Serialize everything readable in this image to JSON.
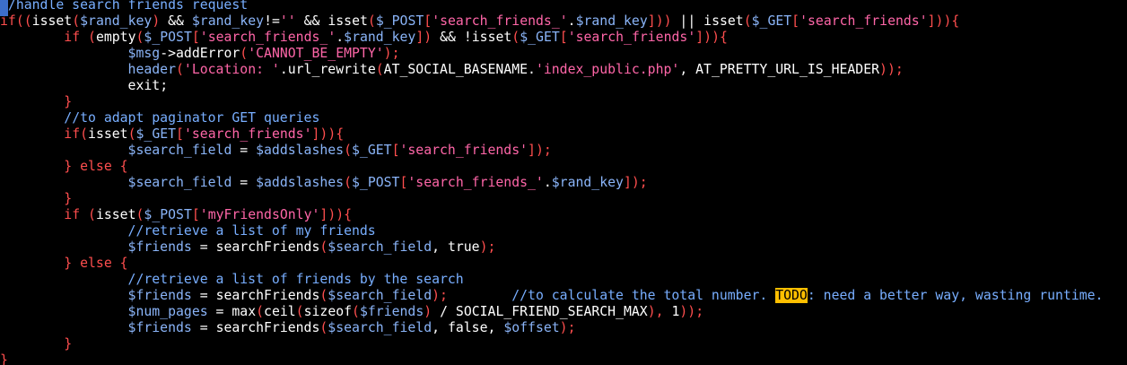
{
  "colors": {
    "background": "#000000",
    "keyword": "#ff4e4e",
    "variable": "#8ab4f8",
    "string": "#ff66a8",
    "comment": "#78aeff",
    "todo_bg": "#ffbf00"
  },
  "code": {
    "lines": [
      [
        {
          "t": "//handle search friends request",
          "c": "cmt"
        }
      ],
      [
        {
          "t": "if",
          "c": "kw"
        },
        {
          "t": "((",
          "c": "kw"
        },
        {
          "t": "isset",
          "c": "fn"
        },
        {
          "t": "(",
          "c": "kw"
        },
        {
          "t": "$rand_key",
          "c": "var"
        },
        {
          "t": ")",
          "c": "kw"
        },
        {
          "t": " && ",
          "c": "op"
        },
        {
          "t": "$rand_key",
          "c": "var"
        },
        {
          "t": "!=",
          "c": "op"
        },
        {
          "t": "''",
          "c": "str"
        },
        {
          "t": " && ",
          "c": "op"
        },
        {
          "t": "isset",
          "c": "fn"
        },
        {
          "t": "(",
          "c": "kw"
        },
        {
          "t": "$_POST",
          "c": "var"
        },
        {
          "t": "[",
          "c": "kw"
        },
        {
          "t": "'search_friends_'",
          "c": "str"
        },
        {
          "t": ".",
          "c": "op"
        },
        {
          "t": "$rand_key",
          "c": "var"
        },
        {
          "t": "]",
          "c": "kw"
        },
        {
          "t": "))",
          "c": "kw"
        },
        {
          "t": " || ",
          "c": "op"
        },
        {
          "t": "isset",
          "c": "fn"
        },
        {
          "t": "(",
          "c": "kw"
        },
        {
          "t": "$_GET",
          "c": "var"
        },
        {
          "t": "[",
          "c": "kw"
        },
        {
          "t": "'search_friends'",
          "c": "str"
        },
        {
          "t": "])",
          "c": "kw"
        },
        {
          "t": ")",
          "c": "kw"
        },
        {
          "t": "{",
          "c": "kw"
        }
      ],
      [
        {
          "t": "        ",
          "c": "plain"
        },
        {
          "t": "if",
          "c": "kw"
        },
        {
          "t": " (",
          "c": "kw"
        },
        {
          "t": "empty",
          "c": "fn"
        },
        {
          "t": "(",
          "c": "kw"
        },
        {
          "t": "$_POST",
          "c": "var"
        },
        {
          "t": "[",
          "c": "kw"
        },
        {
          "t": "'search_friends_'",
          "c": "str"
        },
        {
          "t": ".",
          "c": "op"
        },
        {
          "t": "$rand_key",
          "c": "var"
        },
        {
          "t": "]",
          "c": "kw"
        },
        {
          "t": ")",
          "c": "kw"
        },
        {
          "t": " && ",
          "c": "op"
        },
        {
          "t": "!",
          "c": "op"
        },
        {
          "t": "isset",
          "c": "fn"
        },
        {
          "t": "(",
          "c": "kw"
        },
        {
          "t": "$_GET",
          "c": "var"
        },
        {
          "t": "[",
          "c": "kw"
        },
        {
          "t": "'search_friends'",
          "c": "str"
        },
        {
          "t": "])",
          "c": "kw"
        },
        {
          "t": ")",
          "c": "kw"
        },
        {
          "t": "{",
          "c": "kw"
        }
      ],
      [
        {
          "t": "                ",
          "c": "plain"
        },
        {
          "t": "$msg",
          "c": "var"
        },
        {
          "t": "->",
          "c": "op"
        },
        {
          "t": "addError",
          "c": "fn"
        },
        {
          "t": "(",
          "c": "kw"
        },
        {
          "t": "'CANNOT_BE_EMPTY'",
          "c": "str"
        },
        {
          "t": ");",
          "c": "kw"
        }
      ],
      [
        {
          "t": "                ",
          "c": "plain"
        },
        {
          "t": "header",
          "c": "var"
        },
        {
          "t": "(",
          "c": "kw"
        },
        {
          "t": "'Location: '",
          "c": "str"
        },
        {
          "t": ".",
          "c": "op"
        },
        {
          "t": "url_rewrite",
          "c": "fn"
        },
        {
          "t": "(",
          "c": "kw"
        },
        {
          "t": "AT_SOCIAL_BASENAME",
          "c": "const"
        },
        {
          "t": ".",
          "c": "op"
        },
        {
          "t": "'index_public.php'",
          "c": "str"
        },
        {
          "t": ", ",
          "c": "op"
        },
        {
          "t": "AT_PRETTY_URL_IS_HEADER",
          "c": "const"
        },
        {
          "t": "));",
          "c": "kw"
        }
      ],
      [
        {
          "t": "                ",
          "c": "plain"
        },
        {
          "t": "exit",
          "c": "fn"
        },
        {
          "t": ";",
          "c": "op"
        }
      ],
      [
        {
          "t": "        ",
          "c": "plain"
        },
        {
          "t": "}",
          "c": "kw"
        }
      ],
      [
        {
          "t": "        ",
          "c": "plain"
        },
        {
          "t": "//to adapt paginator GET queries",
          "c": "cmt"
        }
      ],
      [
        {
          "t": "        ",
          "c": "plain"
        },
        {
          "t": "if",
          "c": "kw"
        },
        {
          "t": "(",
          "c": "kw"
        },
        {
          "t": "isset",
          "c": "fn"
        },
        {
          "t": "(",
          "c": "kw"
        },
        {
          "t": "$_GET",
          "c": "var"
        },
        {
          "t": "[",
          "c": "kw"
        },
        {
          "t": "'search_friends'",
          "c": "str"
        },
        {
          "t": "])",
          "c": "kw"
        },
        {
          "t": ")",
          "c": "kw"
        },
        {
          "t": "{",
          "c": "kw"
        }
      ],
      [
        {
          "t": "                ",
          "c": "plain"
        },
        {
          "t": "$search_field",
          "c": "var"
        },
        {
          "t": " = ",
          "c": "op"
        },
        {
          "t": "$addslashes",
          "c": "var"
        },
        {
          "t": "(",
          "c": "kw"
        },
        {
          "t": "$_GET",
          "c": "var"
        },
        {
          "t": "[",
          "c": "kw"
        },
        {
          "t": "'search_friends'",
          "c": "str"
        },
        {
          "t": "]);",
          "c": "kw"
        }
      ],
      [
        {
          "t": "        ",
          "c": "plain"
        },
        {
          "t": "} ",
          "c": "kw"
        },
        {
          "t": "else",
          "c": "kw"
        },
        {
          "t": " {",
          "c": "kw"
        }
      ],
      [
        {
          "t": "                ",
          "c": "plain"
        },
        {
          "t": "$search_field",
          "c": "var"
        },
        {
          "t": " = ",
          "c": "op"
        },
        {
          "t": "$addslashes",
          "c": "var"
        },
        {
          "t": "(",
          "c": "kw"
        },
        {
          "t": "$_POST",
          "c": "var"
        },
        {
          "t": "[",
          "c": "kw"
        },
        {
          "t": "'search_friends_'",
          "c": "str"
        },
        {
          "t": ".",
          "c": "op"
        },
        {
          "t": "$rand_key",
          "c": "var"
        },
        {
          "t": "]);",
          "c": "kw"
        }
      ],
      [
        {
          "t": "        ",
          "c": "plain"
        },
        {
          "t": "}",
          "c": "kw"
        }
      ],
      [
        {
          "t": "        ",
          "c": "plain"
        },
        {
          "t": "if",
          "c": "kw"
        },
        {
          "t": " (",
          "c": "kw"
        },
        {
          "t": "isset",
          "c": "fn"
        },
        {
          "t": "(",
          "c": "kw"
        },
        {
          "t": "$_POST",
          "c": "var"
        },
        {
          "t": "[",
          "c": "kw"
        },
        {
          "t": "'myFriendsOnly'",
          "c": "str"
        },
        {
          "t": "])",
          "c": "kw"
        },
        {
          "t": ")",
          "c": "kw"
        },
        {
          "t": "{",
          "c": "kw"
        }
      ],
      [
        {
          "t": "                ",
          "c": "plain"
        },
        {
          "t": "//retrieve a list of my friends",
          "c": "cmt"
        }
      ],
      [
        {
          "t": "                ",
          "c": "plain"
        },
        {
          "t": "$friends",
          "c": "var"
        },
        {
          "t": " = ",
          "c": "op"
        },
        {
          "t": "searchFriends",
          "c": "fn"
        },
        {
          "t": "(",
          "c": "kw"
        },
        {
          "t": "$search_field",
          "c": "var"
        },
        {
          "t": ", ",
          "c": "op"
        },
        {
          "t": "true",
          "c": "const"
        },
        {
          "t": ");",
          "c": "kw"
        }
      ],
      [
        {
          "t": "        ",
          "c": "plain"
        },
        {
          "t": "} ",
          "c": "kw"
        },
        {
          "t": "else",
          "c": "kw"
        },
        {
          "t": " {",
          "c": "kw"
        }
      ],
      [
        {
          "t": "                ",
          "c": "plain"
        },
        {
          "t": "//retrieve a list of friends by the search",
          "c": "cmt"
        }
      ],
      [
        {
          "t": "                ",
          "c": "plain"
        },
        {
          "t": "$friends",
          "c": "var"
        },
        {
          "t": " = ",
          "c": "op"
        },
        {
          "t": "searchFriends",
          "c": "fn"
        },
        {
          "t": "(",
          "c": "kw"
        },
        {
          "t": "$search_field",
          "c": "var"
        },
        {
          "t": ");",
          "c": "kw"
        },
        {
          "t": "        ",
          "c": "plain"
        },
        {
          "t": "//to calculate the total number. ",
          "c": "cmt"
        },
        {
          "t": "TODO",
          "c": "todo"
        },
        {
          "t": ": need a better way, wasting runtime.",
          "c": "cmt"
        }
      ],
      [
        {
          "t": "                ",
          "c": "plain"
        },
        {
          "t": "$num_pages",
          "c": "var"
        },
        {
          "t": " = ",
          "c": "op"
        },
        {
          "t": "max",
          "c": "fn"
        },
        {
          "t": "(",
          "c": "kw"
        },
        {
          "t": "ceil",
          "c": "fn"
        },
        {
          "t": "(",
          "c": "kw"
        },
        {
          "t": "sizeof",
          "c": "fn"
        },
        {
          "t": "(",
          "c": "kw"
        },
        {
          "t": "$friends",
          "c": "var"
        },
        {
          "t": ")",
          "c": "kw"
        },
        {
          "t": " / ",
          "c": "op"
        },
        {
          "t": "SOCIAL_FRIEND_SEARCH_MAX",
          "c": "const"
        },
        {
          "t": "), ",
          "c": "kw"
        },
        {
          "t": "1",
          "c": "const"
        },
        {
          "t": "));",
          "c": "kw"
        }
      ],
      [
        {
          "t": "                ",
          "c": "plain"
        },
        {
          "t": "$friends",
          "c": "var"
        },
        {
          "t": " = ",
          "c": "op"
        },
        {
          "t": "searchFriends",
          "c": "fn"
        },
        {
          "t": "(",
          "c": "kw"
        },
        {
          "t": "$search_field",
          "c": "var"
        },
        {
          "t": ", ",
          "c": "op"
        },
        {
          "t": "false",
          "c": "const"
        },
        {
          "t": ", ",
          "c": "op"
        },
        {
          "t": "$offset",
          "c": "var"
        },
        {
          "t": ");",
          "c": "kw"
        }
      ],
      [
        {
          "t": "        ",
          "c": "plain"
        },
        {
          "t": "}",
          "c": "kw"
        }
      ],
      [
        {
          "t": "}",
          "c": "kw"
        }
      ]
    ]
  }
}
